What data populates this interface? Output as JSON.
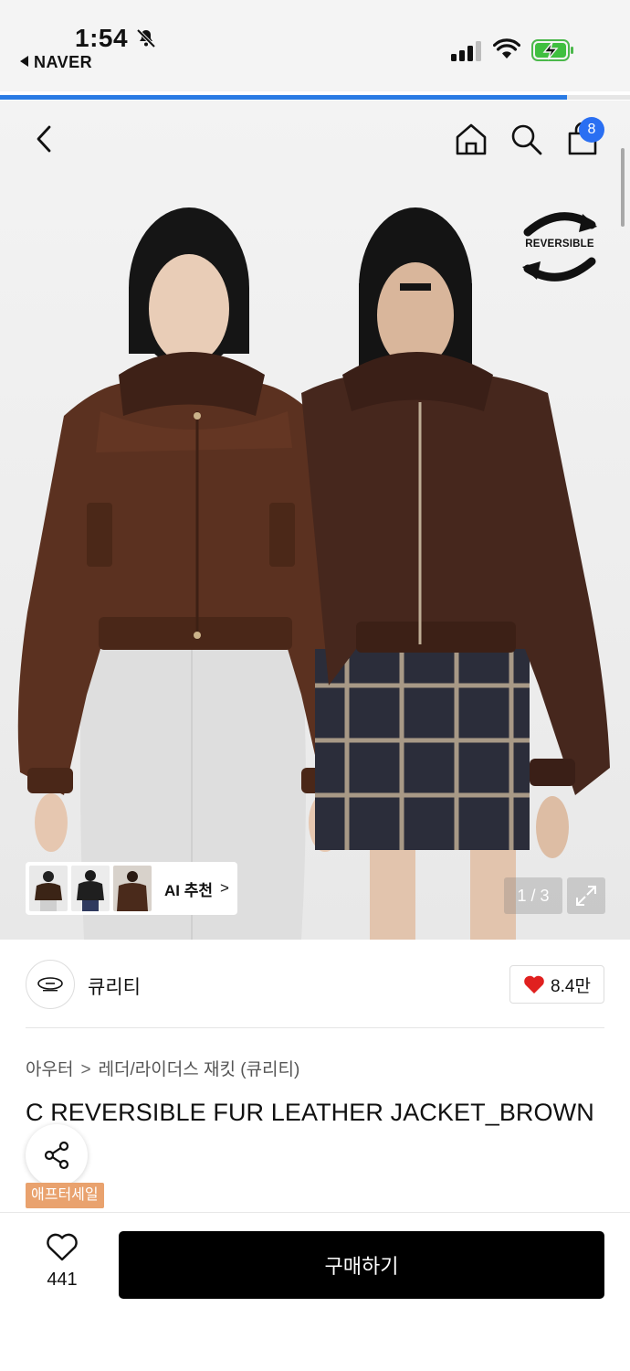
{
  "status_bar": {
    "time": "1:54",
    "back_app": "NAVER",
    "battery_state": "charging"
  },
  "page_load_progress": 0.9,
  "hero": {
    "reversible_label": "REVERSIBLE",
    "cart_count": "8",
    "ai_recommend_label": "AI 추천",
    "ai_chevron": ">",
    "image_counter": "1 / 3",
    "icons": [
      "back-arrow-icon",
      "home-icon",
      "search-icon",
      "shopping-bag-icon",
      "expand-icon",
      "bell-muted-icon"
    ]
  },
  "brand": {
    "name": "큐리티",
    "like_count": "8.4만"
  },
  "breadcrumb": {
    "level1": "아우터",
    "separator": ">",
    "level2": "레더/라이더스 재킷 (큐리티)"
  },
  "product": {
    "title": "C REVERSIBLE FUR LEATHER JACKET_BROWN",
    "sale_badge": "애프터세일"
  },
  "bottom_bar": {
    "wish_count": "441",
    "buy_label": "구매하기"
  },
  "colors": {
    "accent_blue": "#2a6ff2",
    "heart_red": "#e0201f",
    "sale_orange": "#e9a26e",
    "buy_black": "#000000"
  }
}
